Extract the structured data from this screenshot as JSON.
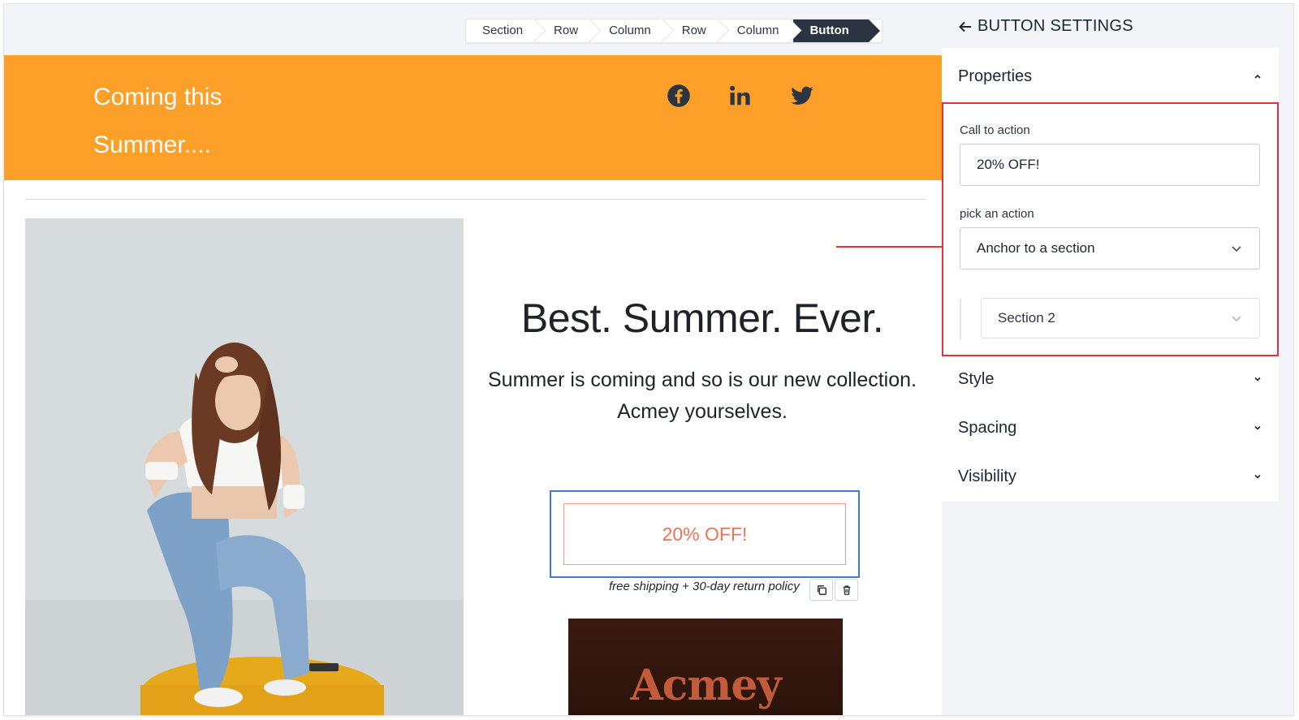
{
  "breadcrumb": {
    "items": [
      "Section",
      "Row",
      "Column",
      "Row",
      "Column",
      "Button"
    ]
  },
  "email": {
    "hero_title": "Coming this Summer....",
    "social": [
      "facebook-icon",
      "linkedin-icon",
      "twitter-icon"
    ],
    "headline": "Best. Summer. Ever.",
    "subtext": "Summer is coming and so is our new collection. Acmey yourselves.",
    "cta_label": "20% OFF!",
    "cta_caption": "free shipping + 30-day return policy",
    "brand_name": "Acmey"
  },
  "panel": {
    "title": "BUTTON SETTINGS",
    "sections": {
      "properties": "Properties",
      "style": "Style",
      "spacing": "Spacing",
      "visibility": "Visibility"
    },
    "call_to_action_label": "Call to action",
    "call_to_action_value": "20% OFF!",
    "action_label": "pick an action",
    "action_value": "Anchor to a section",
    "section_value": "Section 2"
  },
  "colors": {
    "hero": "#fca02a",
    "cta_text": "#f07157",
    "selection": "#3f7ad7",
    "annotation": "#e0333c"
  }
}
